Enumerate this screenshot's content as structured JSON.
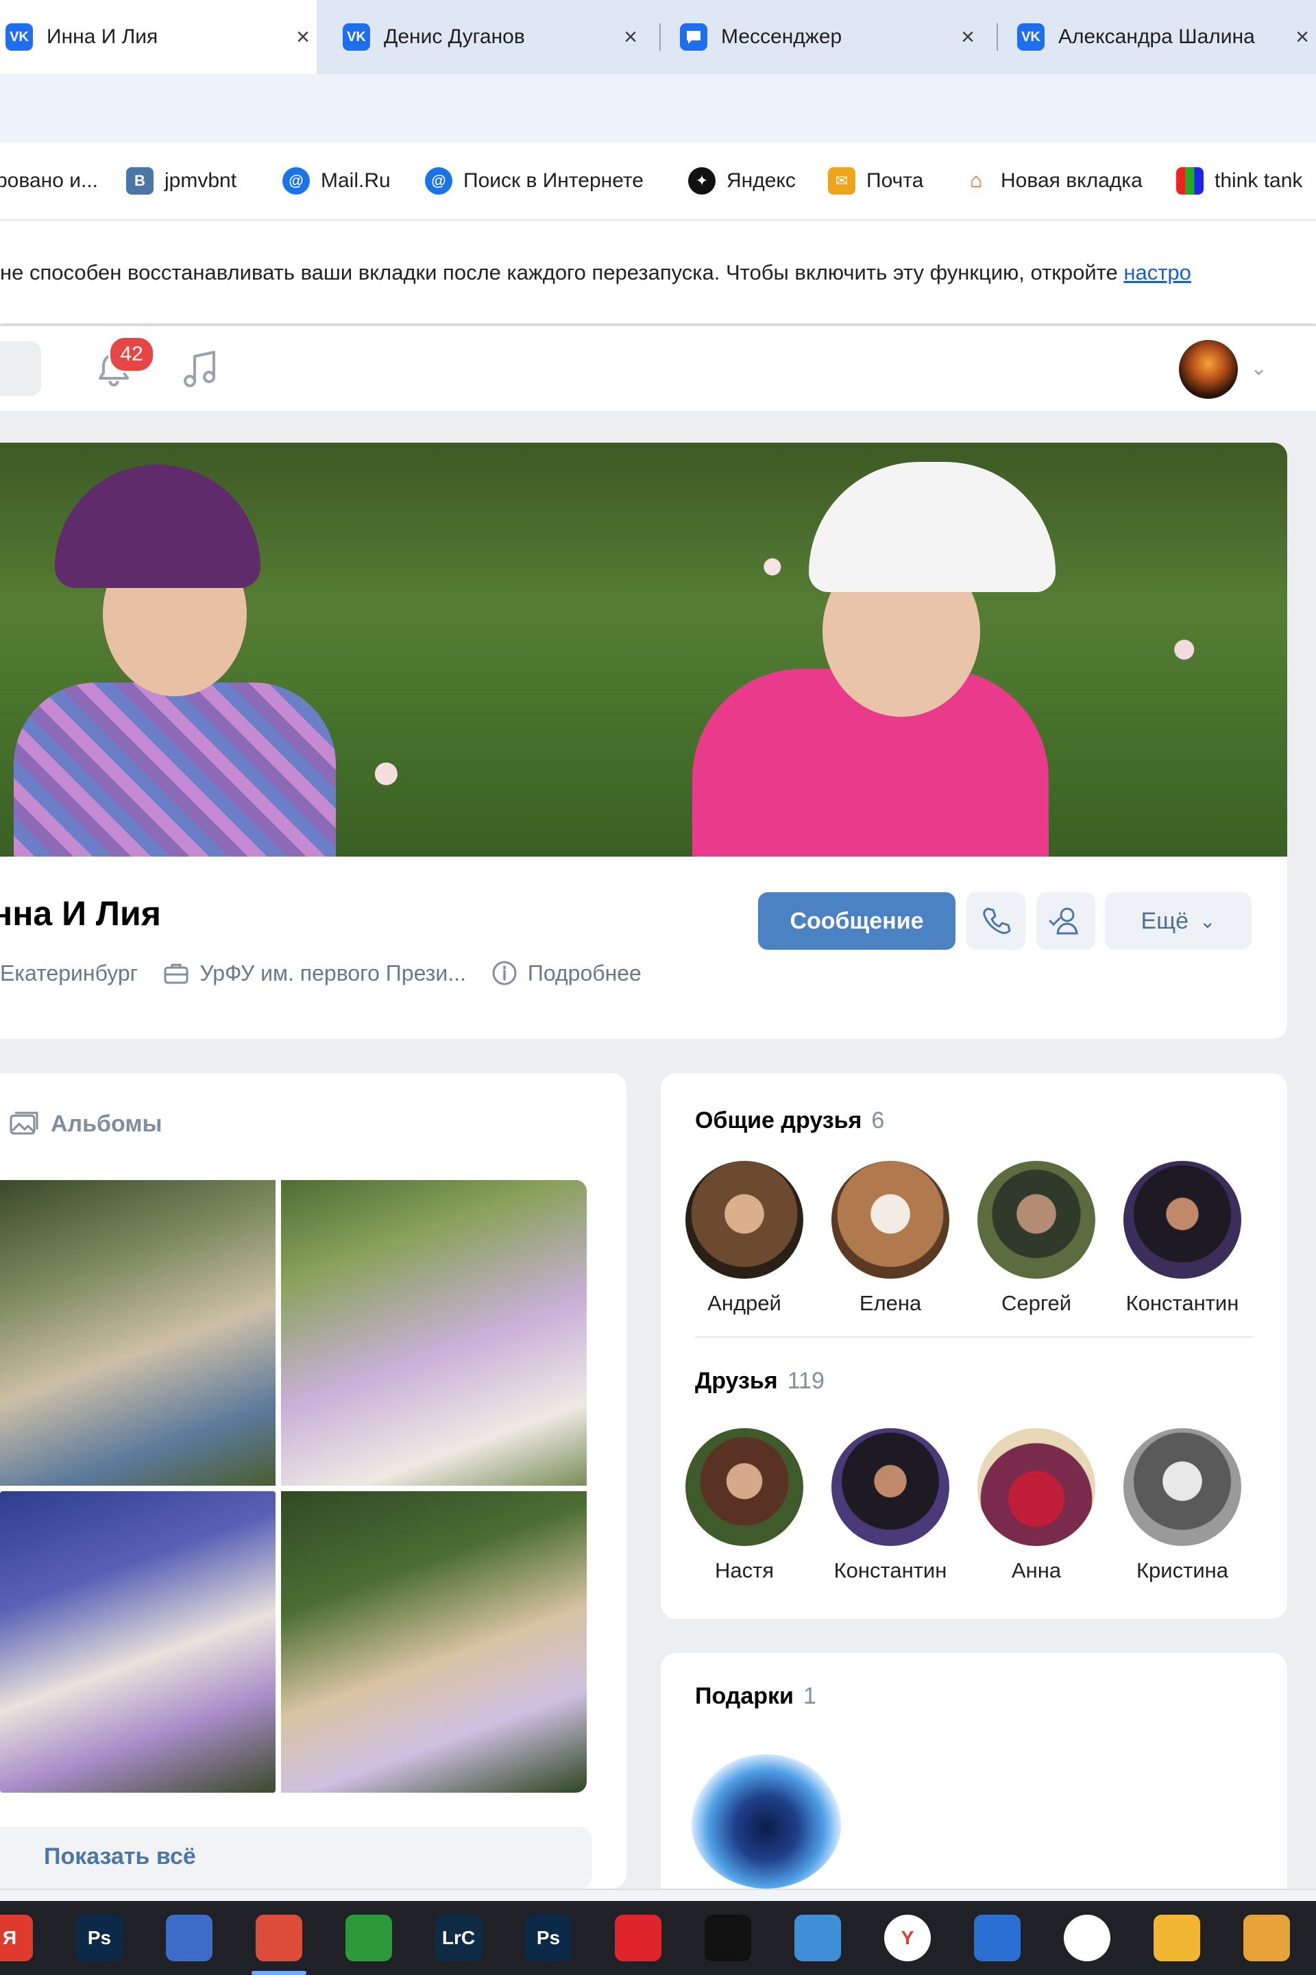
{
  "tabs": [
    {
      "title": "Инна И Лия",
      "icon": "vk-icon"
    },
    {
      "title": "Денис Дуганов",
      "icon": "vk-icon"
    },
    {
      "title": "Мессенджер",
      "icon": "messenger-icon"
    },
    {
      "title": "Александра Шалина",
      "icon": "vk-icon"
    }
  ],
  "bookmarks": [
    {
      "label": "ровано и...",
      "icon": "folder-icon"
    },
    {
      "label": "jpmvbnt",
      "icon": "vk-b-icon"
    },
    {
      "label": "Mail.Ru",
      "icon": "mailru-icon"
    },
    {
      "label": "Поиск в Интернете",
      "icon": "mailru-icon"
    },
    {
      "label": "Яндекс",
      "icon": "yandex-star-icon"
    },
    {
      "label": "Почта",
      "icon": "mail-envelope-icon"
    },
    {
      "label": "Новая вкладка",
      "icon": "house-icon"
    },
    {
      "label": "think tank",
      "icon": "tv-icon"
    }
  ],
  "restore_bar": {
    "text": "не способен восстанавливать ваши вкладки после каждого перезапуска. Чтобы включить эту функцию, откройте ",
    "link": "настро"
  },
  "header": {
    "notifications_count": "42"
  },
  "profile": {
    "name": "нна И Лия",
    "city": "Екатеринбург",
    "university": "УрФУ им. первого Прези...",
    "details": "Подробнее",
    "message_button": "Сообщение",
    "more_button": "Ещё"
  },
  "photos": {
    "albums_label": "Альбомы",
    "show_all": "Показать всё"
  },
  "mutual_friends": {
    "title": "Общие друзья",
    "count": "6",
    "items": [
      {
        "name": "Андрей",
        "color": "#6b4a2f"
      },
      {
        "name": "Елена",
        "color": "#b07a4e"
      },
      {
        "name": "Сергей",
        "color": "#5b6d3f"
      },
      {
        "name": "Константин",
        "color": "#3b2e5a"
      }
    ]
  },
  "friends": {
    "title": "Друзья",
    "count": "119",
    "items": [
      {
        "name": "Настя",
        "color": "#3f5b2c"
      },
      {
        "name": "Константин",
        "color": "#4b3a7a"
      },
      {
        "name": "Анна",
        "color": "#9c2a3a"
      },
      {
        "name": "Кристина",
        "color": "#7a7a7a"
      }
    ]
  },
  "gifts": {
    "title": "Подарки",
    "count": "1"
  },
  "taskbar": [
    {
      "label": "Я",
      "icon": "yandex-browser-icon",
      "color": "#e03a2f"
    },
    {
      "label": "Ps",
      "icon": "photoshop-icon",
      "color": "#0b2a4a"
    },
    {
      "label": "",
      "icon": "camera-icon",
      "color": "#3a6cc8"
    },
    {
      "label": "",
      "icon": "chrome-icon",
      "color": "#dd4b39"
    },
    {
      "label": "",
      "icon": "pen-icon",
      "color": "#2b9a3a"
    },
    {
      "label": "LrC",
      "icon": "lightroom-icon",
      "color": "#0d2b45"
    },
    {
      "label": "Ps",
      "icon": "photoshop-icon",
      "color": "#0b2a4a"
    },
    {
      "label": "",
      "icon": "opera-icon",
      "color": "#e0242b"
    },
    {
      "label": "",
      "icon": "tiktok-icon",
      "color": "#111111"
    },
    {
      "label": "",
      "icon": "screen-icon",
      "color": "#3f8fd8"
    },
    {
      "label": "Y",
      "icon": "yandex-icon",
      "color": "#ffffff"
    },
    {
      "label": "",
      "icon": "shield-icon",
      "color": "#2a6fd1"
    },
    {
      "label": "",
      "icon": "ring-icon",
      "color": "#ffffff"
    },
    {
      "label": "",
      "icon": "folder-icon",
      "color": "#f2b632"
    },
    {
      "label": "",
      "icon": "eye-icon",
      "color": "#e7a33a"
    }
  ]
}
